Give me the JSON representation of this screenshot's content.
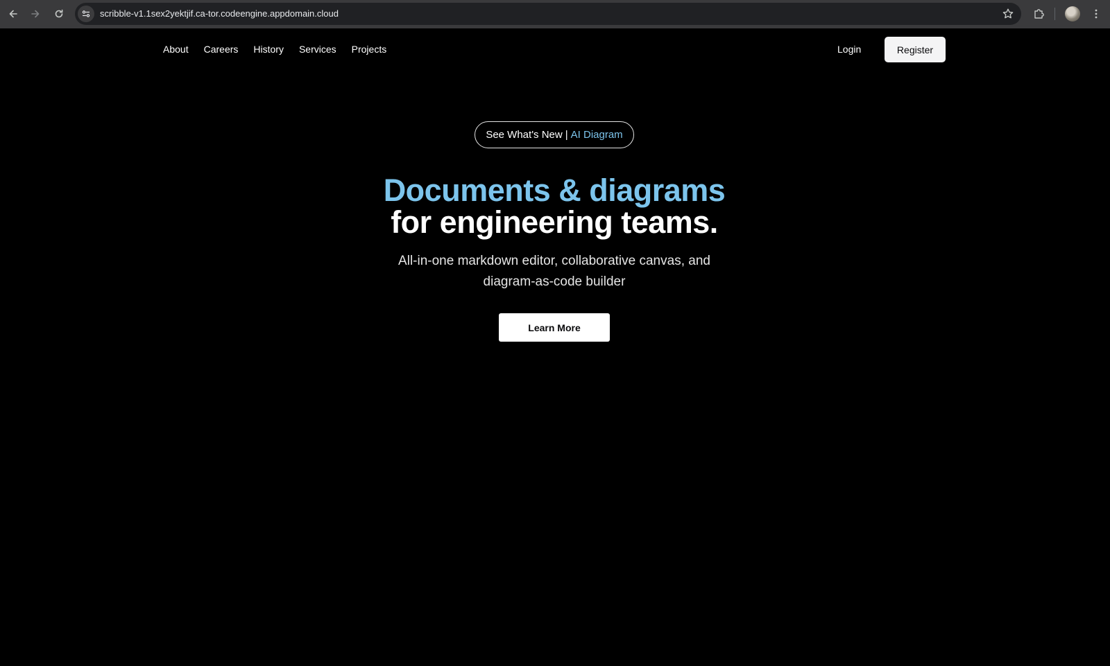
{
  "browser": {
    "url": "scribble-v1.1sex2yektjif.ca-tor.codeengine.appdomain.cloud",
    "icons": [
      "back-arrow-icon",
      "forward-arrow-icon",
      "reload-icon",
      "site-info-icon",
      "bookmark-star-icon",
      "extensions-icon",
      "profile-avatar",
      "more-menu-icon"
    ]
  },
  "nav": {
    "links": [
      "About",
      "Careers",
      "History",
      "Services",
      "Projects"
    ],
    "login": "Login",
    "register": "Register"
  },
  "hero": {
    "pill": {
      "prefix": "See What's New",
      "separator": "|",
      "accent": "AI Diagram"
    },
    "headline_line1": "Documents & diagrams",
    "headline_line2": "for engineering teams.",
    "subhead_line1": "All-in-one markdown editor, collaborative canvas, and",
    "subhead_line2": "diagram-as-code builder",
    "cta": "Learn More"
  },
  "colors": {
    "background": "#000000",
    "accent": "#7cc4ec",
    "chrome": "#3a3a3c",
    "omnibox": "#202124"
  }
}
